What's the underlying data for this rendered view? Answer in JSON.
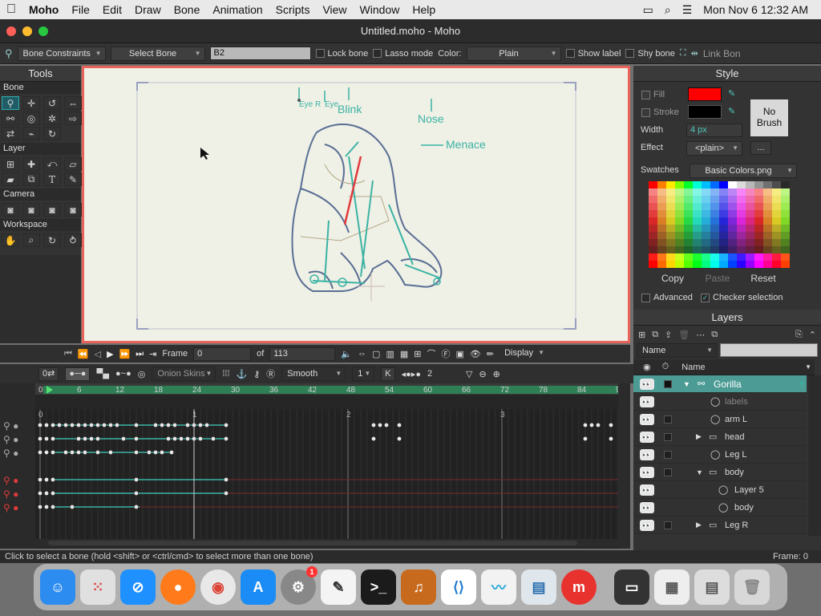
{
  "menubar": {
    "app": "Moho",
    "items": [
      "File",
      "Edit",
      "Draw",
      "Bone",
      "Animation",
      "Scripts",
      "View",
      "Window",
      "Help"
    ],
    "clock": "Mon Nov 6  12:32 AM"
  },
  "window": {
    "title": "Untitled.moho - Moho"
  },
  "options": {
    "mode": "Bone Constraints",
    "select_bone": "Select Bone",
    "bone_name": "B2",
    "lock_bone": "Lock bone",
    "lasso_mode": "Lasso mode",
    "color_label": "Color:",
    "color_value": "Plain",
    "show_label": "Show label",
    "shy_bone": "Shy bone",
    "link_bone": "Link Bon"
  },
  "tools": {
    "title": "Tools",
    "sections": {
      "bone": "Bone",
      "layer": "Layer",
      "camera": "Camera",
      "workspace": "Workspace"
    }
  },
  "canvas": {
    "labels": {
      "eye_r": "Eye R",
      "eye": "Eye",
      "blink": "Blink",
      "nose": "Nose",
      "menace": "Menace"
    }
  },
  "transport": {
    "frame_label": "Frame",
    "frame": "0",
    "of_label": "of",
    "total": "113",
    "display": "Display"
  },
  "timeline": {
    "onion": "Onion Skins",
    "interp": "Smooth",
    "step": "1",
    "key_label": "K",
    "count": "2",
    "ruler": [
      "0",
      "6",
      "12",
      "18",
      "24",
      "30",
      "36",
      "42",
      "48",
      "54",
      "60",
      "66",
      "72",
      "78",
      "84",
      "9"
    ],
    "seconds": [
      "0",
      "1",
      "2",
      "3"
    ]
  },
  "style": {
    "title": "Style",
    "fill": "Fill",
    "stroke": "Stroke",
    "width_label": "Width",
    "width": "4 px",
    "effect_label": "Effect",
    "effect": "<plain>",
    "effect_more": "...",
    "no_brush": "No Brush",
    "swatches_label": "Swatches",
    "swatches": "Basic Colors.png",
    "copy": "Copy",
    "paste": "Paste",
    "reset": "Reset",
    "advanced": "Advanced",
    "checker": "Checker selection",
    "fill_color": "#ff0000",
    "stroke_color": "#000000"
  },
  "layers": {
    "title": "Layers",
    "filter": "Name contains...",
    "name_col": "Name",
    "items": [
      "Gorilla",
      "labels",
      "arm L",
      "head",
      "Leg L",
      "body",
      "Layer 5",
      "body",
      "Leg R"
    ]
  },
  "status": {
    "hint": "Click to select a bone (hold <shift> or <ctrl/cmd> to select more than one bone)",
    "frame": "Frame: 0"
  }
}
